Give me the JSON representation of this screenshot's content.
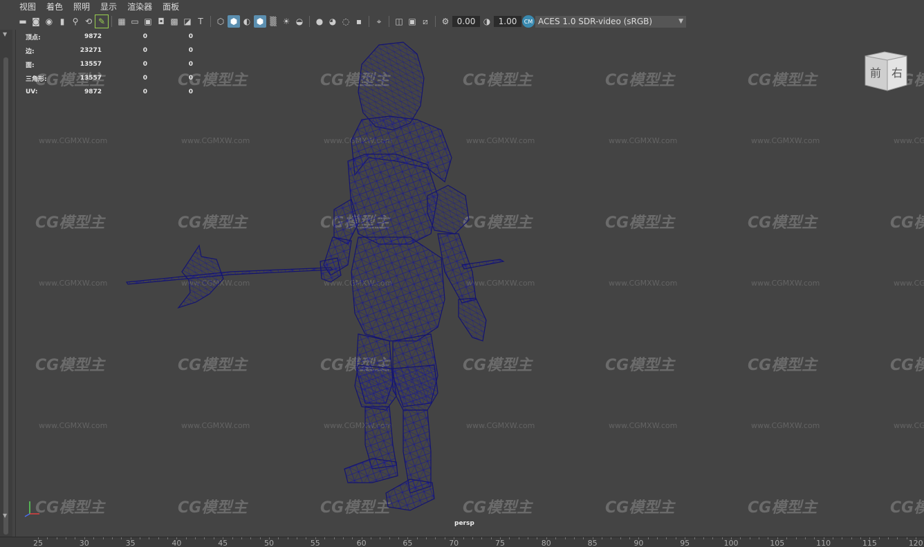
{
  "menu": [
    "视图",
    "着色",
    "照明",
    "显示",
    "渲染器",
    "面板"
  ],
  "toolbar": {
    "exposure_value": "0.00",
    "gamma_value": "1.00",
    "colorspace_button": "cm-icon",
    "colorspace_value": "ACES 1.0 SDR-video (sRGB)",
    "icons": [
      "camera-select-icon",
      "camera-lock-icon",
      "camera-attr-icon",
      "bookmark-icon",
      "image-plane-icon",
      "2d-pan-zoom-icon",
      "grease-pencil-icon",
      "grid-icon",
      "film-gate-icon",
      "resolution-gate-icon",
      "gate-mask-icon",
      "field-chart-icon",
      "safe-action-icon",
      "safe-title-icon",
      "wireframe-icon",
      "smooth-shade-icon",
      "default-material-icon",
      "wireframe-on-shaded-icon",
      "xray-icon",
      "use-all-lights-icon",
      "shadows-icon",
      "screen-space-ao-icon",
      "motion-blur-icon",
      "multisample-aa-icon",
      "depth-of-field-icon",
      "isolate-select-icon",
      "xray-joints-icon",
      "xray-active-icon",
      "backface-culling-icon",
      "exposure-icon",
      "gamma-icon"
    ]
  },
  "hud": {
    "rows": [
      {
        "label": "顶点:",
        "values": [
          "9872",
          "0",
          "0"
        ]
      },
      {
        "label": "边:",
        "values": [
          "23271",
          "0",
          "0"
        ]
      },
      {
        "label": "面:",
        "values": [
          "13557",
          "0",
          "0"
        ]
      },
      {
        "label": "三角形:",
        "values": [
          "13557",
          "0",
          "0"
        ]
      },
      {
        "label": "UV:",
        "values": [
          "9872",
          "0",
          "0"
        ]
      }
    ]
  },
  "viewcube": {
    "front": "前",
    "right": "右"
  },
  "viewport_label": "persp",
  "watermark": {
    "logo": "CG模型主",
    "url": "www.CGMXW.com"
  },
  "ruler_ticks": [
    "25",
    "30",
    "35",
    "40",
    "45",
    "50",
    "55",
    "60",
    "65",
    "70",
    "75",
    "80",
    "85",
    "90",
    "95",
    "100",
    "105",
    "110",
    "115",
    "120"
  ],
  "colors": {
    "wire": "#1a1a8c",
    "viewport_bg": "#444444",
    "accent": "#5b8fb0"
  }
}
